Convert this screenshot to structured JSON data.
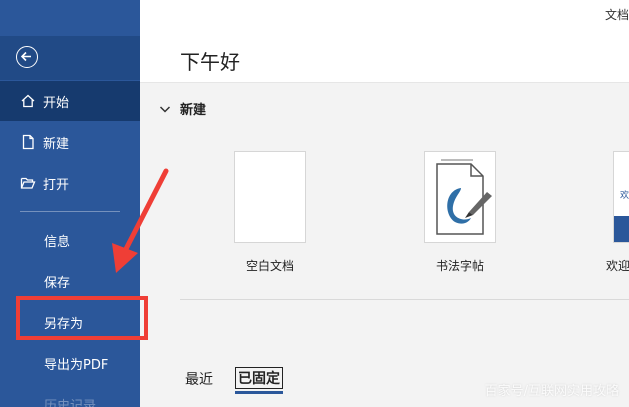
{
  "window": {
    "title": "文档"
  },
  "sidebar": {
    "items": [
      {
        "label": "开始",
        "icon": "home-icon"
      },
      {
        "label": "新建",
        "icon": "new-doc-icon"
      },
      {
        "label": "打开",
        "icon": "folder-open-icon"
      },
      {
        "label": "信息"
      },
      {
        "label": "保存"
      },
      {
        "label": "另存为"
      },
      {
        "label": "导出为PDF"
      },
      {
        "label": "历史记录"
      }
    ]
  },
  "main": {
    "greeting": "下午好",
    "new_section": {
      "title": "新建"
    },
    "templates": [
      {
        "label": "空白文档"
      },
      {
        "label": "书法字帖"
      },
      {
        "label": "欢迎",
        "thumb_text": "欢"
      }
    ],
    "tabs": [
      {
        "label": "最近"
      },
      {
        "label": "已固定"
      }
    ]
  },
  "watermark": "百家号/互联网实用攻略",
  "colors": {
    "sidebar": "#2b579a",
    "active": "#163a6e",
    "annotation": "#ef3e36"
  }
}
